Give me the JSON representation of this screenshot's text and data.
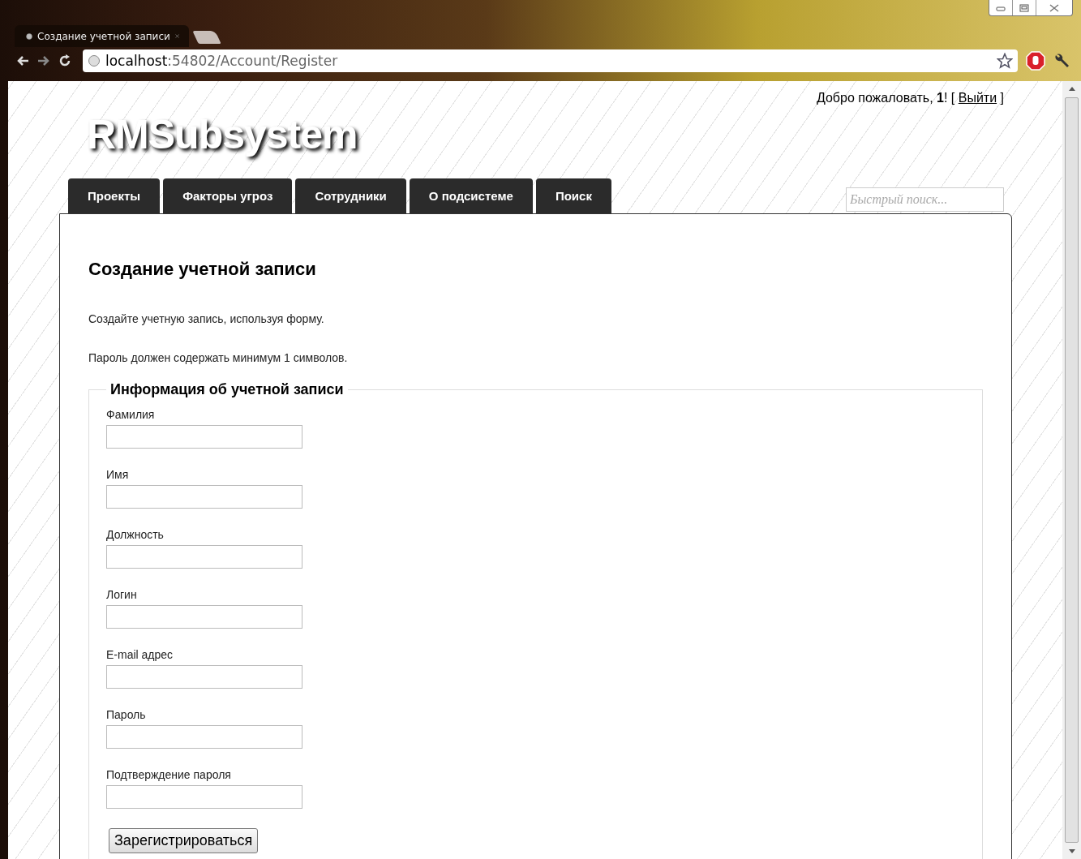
{
  "browser": {
    "tab_title": "Создание учетной записи",
    "url_host": "localhost",
    "url_path": ":54802/Account/Register"
  },
  "header": {
    "welcome_before": "Добро пожаловать, **1**! [ ",
    "logout_link": "Выйти",
    "welcome_after": " ]",
    "logo": "RMSubsystem",
    "search": {
      "placeholder": "Быстрый поиск..."
    }
  },
  "nav": [
    "Проекты",
    "Факторы угроз",
    "Сотрудники",
    "О подсистеме",
    "Поиск"
  ],
  "page": {
    "title": "Создание учетной записи",
    "intro": "Создайте учетную запись, используя форму.",
    "password_note": "Пароль должен содержать минимум 1 символов.",
    "fieldset": {
      "legend": "Информация об учетной записи",
      "fields": [
        {
          "label": "Фамилия"
        },
        {
          "label": "Имя"
        },
        {
          "label": "Должность"
        },
        {
          "label": "Логин"
        },
        {
          "label": "E-mail адрес"
        },
        {
          "label": "Пароль"
        },
        {
          "label": "Подтверждение пароля"
        }
      ]
    },
    "submit": "Зарегистрироваться"
  }
}
